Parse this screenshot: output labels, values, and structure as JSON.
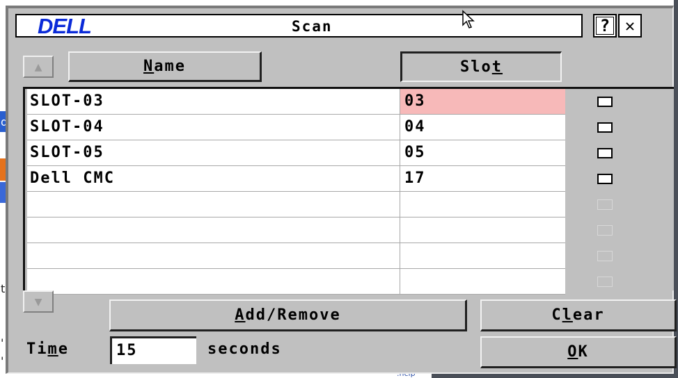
{
  "background": {
    "left_chars": [
      "d",
      "t",
      "'",
      "'"
    ],
    "bottom_text": ".ncip"
  },
  "dialog": {
    "logo": "DELL",
    "title": "Scan",
    "help_label": "?",
    "close_label": "✕"
  },
  "headers": {
    "name": {
      "pre": "",
      "key": "N",
      "post": "ame"
    },
    "slot": {
      "pre": "Slo",
      "key": "t",
      "post": ""
    },
    "scroll_up_icon": "▲",
    "scroll_down_icon": "▼"
  },
  "rows": [
    {
      "name": "SLOT-03",
      "slot": "03",
      "selected": true,
      "checked": false
    },
    {
      "name": "SLOT-04",
      "slot": "04",
      "selected": false,
      "checked": false
    },
    {
      "name": "SLOT-05",
      "slot": "05",
      "selected": false,
      "checked": false
    },
    {
      "name": "Dell CMC",
      "slot": "17",
      "selected": false,
      "checked": false
    },
    {
      "name": "",
      "slot": "",
      "selected": false,
      "checked": false
    },
    {
      "name": "",
      "slot": "",
      "selected": false,
      "checked": false
    },
    {
      "name": "",
      "slot": "",
      "selected": false,
      "checked": false
    },
    {
      "name": "",
      "slot": "",
      "selected": false,
      "checked": false
    }
  ],
  "buttons": {
    "add_remove": {
      "pre": "",
      "key": "A",
      "post": "dd/Remove"
    },
    "clear": {
      "pre": "C",
      "key": "l",
      "post": "ear"
    },
    "ok": {
      "pre": "",
      "key": "O",
      "post": "K"
    }
  },
  "time": {
    "label": {
      "pre": "Ti",
      "key": "m",
      "post": "e"
    },
    "value": "15",
    "units": "seconds"
  },
  "colors": {
    "dialog_bg": "#c0c0c0",
    "logo_blue": "#0a2ad8",
    "selected_bg": "#f7b9b9"
  }
}
